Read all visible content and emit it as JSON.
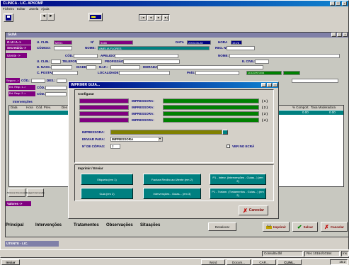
{
  "app": {
    "title": "CLINICA - LIC. APKOMP",
    "menu": [
      "Ficheiro",
      "Editar",
      "Janela",
      "Ajuda"
    ],
    "nav": [
      "|◄",
      "◄",
      "►",
      "►|"
    ]
  },
  "guia": {
    "title": "GUIA",
    "label_guia": "G U I A ->",
    "label_secretaria": "Secretária ->",
    "u_clin_label": "U. CLIN.",
    "u_clin": "ME01",
    "n_label": "Nº",
    "n": "9465",
    "data_label": "DATA",
    "data": "2003-08-28",
    "hora_label": "HORA",
    "hora": "15:26",
    "codigo_label": "CÓDIGO:",
    "nome_label": "NOME:",
    "nome": "AMELIA FLORES",
    "reg_label": "REG. Nº",
    "utente_label": "Utente ->",
    "cod_label": "CÓD.:",
    "apelido_label": "APELIDO:",
    "nome2_label": "NOME:",
    "uclin2_label": "U. CLIN.:",
    "telefone_label": "TELEFONE:",
    "profissao_label": "PROFISSÃO:",
    "ecivil_label": "E. CIVIL:",
    "bnasc_label": "D. NASC.:",
    "idade_label": "IDADE:",
    "nif_label": "N.I.F.:",
    "morada_label": "MORADA:",
    "cpostal_label": "C. POSTAL:",
    "localidade_label": "LOCALIDADE:",
    "pais_label": "PAÍS:",
    "pais_code": "LD.424.557-0004",
    "seguro_label": "Seguro ->",
    "cod3_label": "CÓD.:",
    "des_label": "DES.:",
    "ent1_label": "Ent. Resp. 1 ->",
    "ent2_label": "Ent. Resp. 2 ->",
    "intervencoes_title": "Intervenções",
    "columns": [
      "Data",
      "Hora",
      "Cód. Prev.",
      "Des"
    ],
    "right_columns": [
      "% Comport.",
      "Taxa Moderadora"
    ],
    "row_values": [
      "0.00",
      "0.00"
    ],
    "adicionar": "Adicionar Intervenção",
    "apagar": "Apagar Intervenção",
    "valores_label": "Valores ->",
    "desalocar": "Desalocar"
  },
  "tabs": [
    "Principal",
    "Intervenções",
    "Tratamentos",
    "Observações",
    "Situações"
  ],
  "footer": {
    "imprimir": "Imprimir",
    "salvar": "Salvar",
    "cancelar": "Cancelar",
    "utente": "UTENTE - LIC.",
    "consulta": "Consulta dbl",
    "rec": "Rec 10164/10164",
    "ins": "Ins"
  },
  "modal": {
    "title": "IMPRIMIR GUIA...",
    "configurar": "Configurar",
    "printers": [
      {
        "label": "IMPRESSORA:",
        "num": "( 1 )"
      },
      {
        "label": "IMPRESSORA:",
        "num": "( 2 )"
      },
      {
        "label": "IMPRESSORA:",
        "num": "( 3 )"
      },
      {
        "label": "IMPRESSORA:",
        "num": "( 4 )"
      }
    ],
    "impressora_label": "IMPRESSORA:",
    "enviar_label": "ENVIAR PARA:",
    "enviar_value": "IMPRESSORA",
    "copias_label": "Nº DE CÓPIAS:",
    "copias_value": "2",
    "ver_label": "VER NO ECRÃ",
    "imprimir_enviar": "Imprimir / Enviar",
    "print_buttons": [
      "Etiqueta (em 1)",
      "Factura Recibo ao Utente (em 2)",
      "P1 - Interv. (Intervenções - Guias...) (em 2)",
      "Guia (em 2)",
      "Intervenções - Guias... (em 3)",
      "P1 - Tratam. (Tratamentos - Guias...) (em 2)"
    ],
    "cancelar": "Cancelar"
  },
  "taskbar": {
    "start": "Iniciar",
    "items": [
      "Word",
      "Docum...",
      "CAR...",
      "CLINI..."
    ],
    "clock": "15:2"
  },
  "colors": {
    "navy": "#000080",
    "purple": "#800080",
    "green": "#008000",
    "teal": "#008080",
    "olive": "#808000"
  }
}
